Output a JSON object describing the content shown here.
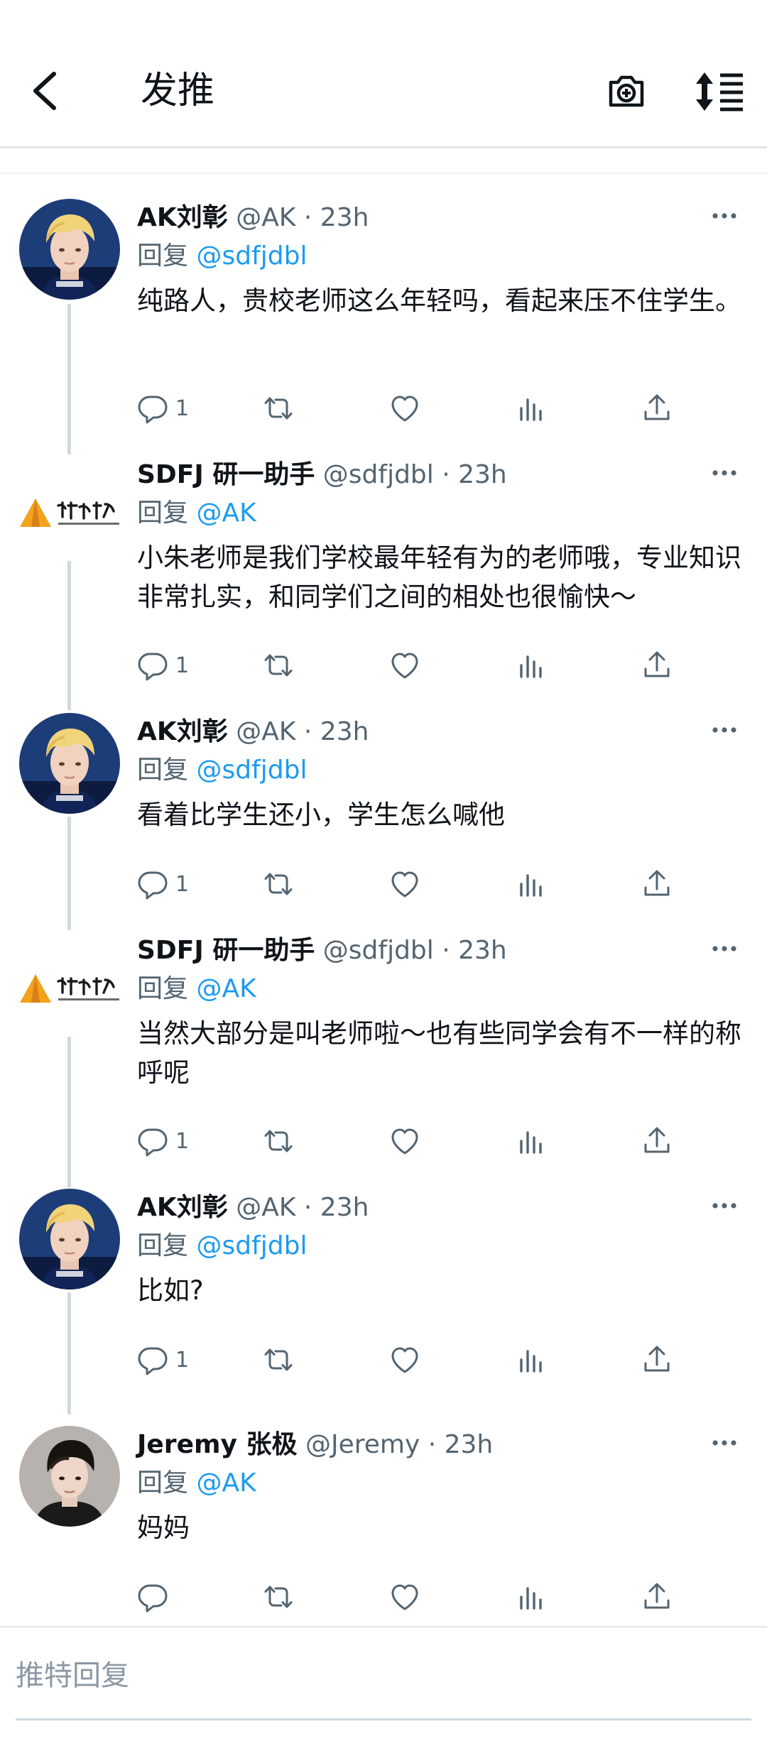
{
  "header": {
    "title": "发推"
  },
  "tweets": [
    {
      "name": "AK刘彰",
      "handle": "@AK · 23h",
      "reply_prefix": "回复",
      "reply_to": "@sdfjdbl",
      "text": "纯路人，贵校老师这么年轻吗，看起来压不住学生。",
      "reply_count": "1"
    },
    {
      "name": "SDFJ 研一助手",
      "handle": "@sdfjdbl · 23h",
      "reply_prefix": "回复",
      "reply_to": "@AK",
      "text": "小朱老师是我们学校最年轻有为的老师哦，专业知识非常扎实，和同学们之间的相处也很愉快～",
      "reply_count": "1"
    },
    {
      "name": "AK刘彰",
      "handle": "@AK · 23h",
      "reply_prefix": "回复",
      "reply_to": "@sdfjdbl",
      "text": "看着比学生还小，学生怎么喊他",
      "reply_count": "1"
    },
    {
      "name": "SDFJ 研一助手",
      "handle": "@sdfjdbl · 23h",
      "reply_prefix": "回复",
      "reply_to": "@AK",
      "text": "当然大部分是叫老师啦～也有些同学会有不一样的称呼呢",
      "reply_count": "1"
    },
    {
      "name": "AK刘彰",
      "handle": "@AK · 23h",
      "reply_prefix": "回复",
      "reply_to": "@sdfjdbl",
      "text": "比如?",
      "reply_count": "1"
    },
    {
      "name": "Jeremy 张极",
      "handle": "@Jeremy · 23h",
      "reply_prefix": "回复",
      "reply_to": "@AK",
      "text": "妈妈",
      "reply_count": ""
    }
  ],
  "compose": {
    "placeholder": "推特回复"
  },
  "icons": {
    "back": "chevron-left-icon",
    "camera": "camera-plus-icon",
    "sort": "sort-lines-icon",
    "more": "more-dots-icon",
    "reply": "reply-bubble-icon",
    "retweet": "retweet-icon",
    "like": "heart-icon",
    "views": "views-bars-icon",
    "share": "share-icon"
  },
  "colors": {
    "link": "#1d9bf0",
    "secondary": "#536471",
    "logo_orange": "#f2a21b"
  }
}
